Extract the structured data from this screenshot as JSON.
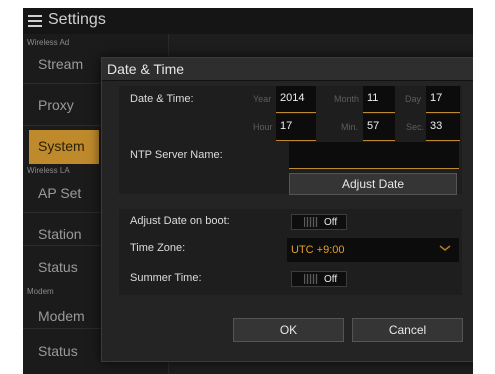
{
  "app": {
    "title": "Settings",
    "menu_icon": "hamburger-menu-icon"
  },
  "sidebar": {
    "sections": [
      {
        "label": "Wireless Ad",
        "items": [
          {
            "label": "Stream"
          },
          {
            "label": "Proxy"
          },
          {
            "label": "System",
            "active": true
          }
        ]
      },
      {
        "label": "Wireless LA",
        "items": [
          {
            "label": "AP Set"
          },
          {
            "label": "Station"
          },
          {
            "label": "Status"
          }
        ]
      },
      {
        "label": "Modem",
        "items": [
          {
            "label": "Modem"
          },
          {
            "label": "Status"
          }
        ]
      }
    ],
    "accent_color": "#bf8a2c"
  },
  "dialog": {
    "title": "Date & Time",
    "date_time_label": "Date & Time:",
    "year_unit": "Year",
    "year": "2014",
    "month_unit": "Month",
    "month": "11",
    "day_unit": "Day",
    "day": "17",
    "hour_unit": "Hour",
    "hour": "17",
    "min_unit": "Min.",
    "minute": "57",
    "sec_unit": "Sec.",
    "second": "33",
    "ntp_label": "NTP Server Name:",
    "ntp_value": "",
    "adjust_date_button": "Adjust Date",
    "adjust_on_boot_label": "Adjust Date on boot:",
    "adjust_on_boot_value": "Off",
    "timezone_label": "Time Zone:",
    "timezone_value": "UTC +9:00",
    "summer_time_label": "Summer Time:",
    "summer_time_value": "Off",
    "ok_button": "OK",
    "cancel_button": "Cancel"
  }
}
